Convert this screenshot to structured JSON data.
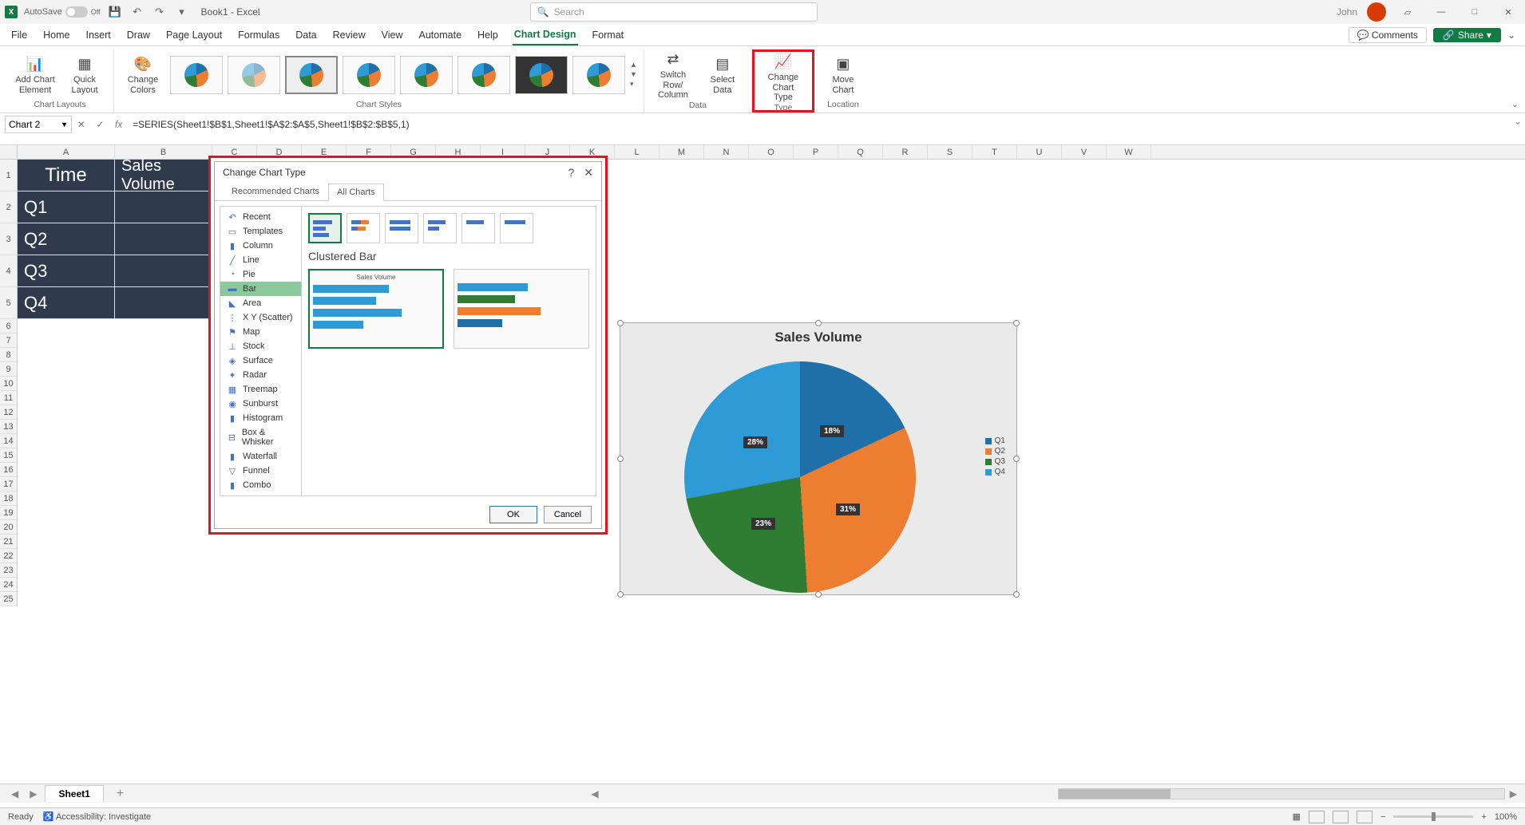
{
  "titlebar": {
    "autosave": "AutoSave",
    "autosave_state": "Off",
    "doc": "Book1 - Excel",
    "search_placeholder": "Search",
    "user": "John"
  },
  "ribbon": {
    "tabs": [
      "File",
      "Home",
      "Insert",
      "Draw",
      "Page Layout",
      "Formulas",
      "Data",
      "Review",
      "View",
      "Automate",
      "Help",
      "Chart Design",
      "Format"
    ],
    "active_tab": "Chart Design",
    "comments": "Comments",
    "share": "Share",
    "groups": {
      "layouts": "Chart Layouts",
      "styles": "Chart Styles",
      "data": "Data",
      "type": "Type",
      "location": "Location"
    },
    "buttons": {
      "add_element": "Add Chart Element",
      "quick_layout": "Quick Layout",
      "change_colors": "Change Colors",
      "switch": "Switch Row/ Column",
      "select_data": "Select Data",
      "change_type": "Change Chart Type",
      "move_chart": "Move Chart"
    }
  },
  "formula": {
    "name_box": "Chart 2",
    "formula": "=SERIES(Sheet1!$B$1,Sheet1!$A$2:$A$5,Sheet1!$B$2:$B$5,1)"
  },
  "columns": [
    "A",
    "B",
    "C",
    "D",
    "E",
    "F",
    "G",
    "H",
    "I",
    "J",
    "K",
    "L",
    "M",
    "N",
    "O",
    "P",
    "Q",
    "R",
    "S",
    "T",
    "U",
    "V",
    "W"
  ],
  "rows_tall": [
    "1",
    "2",
    "3",
    "4",
    "5"
  ],
  "rows_small": [
    "6",
    "7",
    "8",
    "9",
    "10",
    "11",
    "12",
    "13",
    "14",
    "15",
    "16",
    "17",
    "18",
    "19",
    "20",
    "21",
    "22",
    "23",
    "24",
    "25"
  ],
  "table": {
    "headers": [
      "Time",
      "Sales Volume"
    ],
    "rows": [
      "Q1",
      "Q2",
      "Q3",
      "Q4"
    ]
  },
  "dialog": {
    "title": "Change Chart Type",
    "tab_recommended": "Recommended Charts",
    "tab_all": "All Charts",
    "types": [
      "Recent",
      "Templates",
      "Column",
      "Line",
      "Pie",
      "Bar",
      "Area",
      "X Y (Scatter)",
      "Map",
      "Stock",
      "Surface",
      "Radar",
      "Treemap",
      "Sunburst",
      "Histogram",
      "Box & Whisker",
      "Waterfall",
      "Funnel",
      "Combo"
    ],
    "selected_type": "Bar",
    "subtype_label": "Clustered Bar",
    "preview_title": "Sales Volume",
    "ok": "OK",
    "cancel": "Cancel"
  },
  "chart_data": {
    "type": "pie",
    "title": "Sales Volume",
    "categories": [
      "Q1",
      "Q2",
      "Q3",
      "Q4"
    ],
    "values_pct": [
      18,
      31,
      23,
      28
    ],
    "labels": [
      "18%",
      "31%",
      "23%",
      "28%"
    ],
    "colors": [
      "#1f6fa8",
      "#ed7d31",
      "#2f7d32",
      "#2e9bd6"
    ]
  },
  "sheet": {
    "active": "Sheet1"
  },
  "status": {
    "ready": "Ready",
    "accessibility": "Accessibility: Investigate",
    "zoom": "100%"
  }
}
